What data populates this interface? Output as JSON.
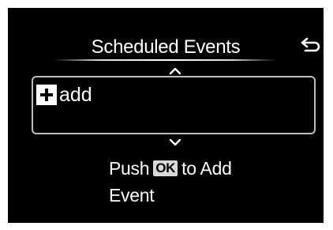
{
  "header": {
    "title": "Scheduled Events",
    "back_icon": "return-arrow-icon"
  },
  "list": {
    "scroll_up_icon": "chevron-up-icon",
    "scroll_down_icon": "chevron-down-icon",
    "items": [
      {
        "icon": "plus-box-icon",
        "label": "add"
      }
    ]
  },
  "hint": {
    "push": "Push",
    "button_label": "OK",
    "to_add": "to Add",
    "event": "Event"
  },
  "colors": {
    "background": "#000000",
    "text": "#ffffff",
    "ok_badge": "#d9d9d9",
    "list_border": "#bdbdbd"
  }
}
